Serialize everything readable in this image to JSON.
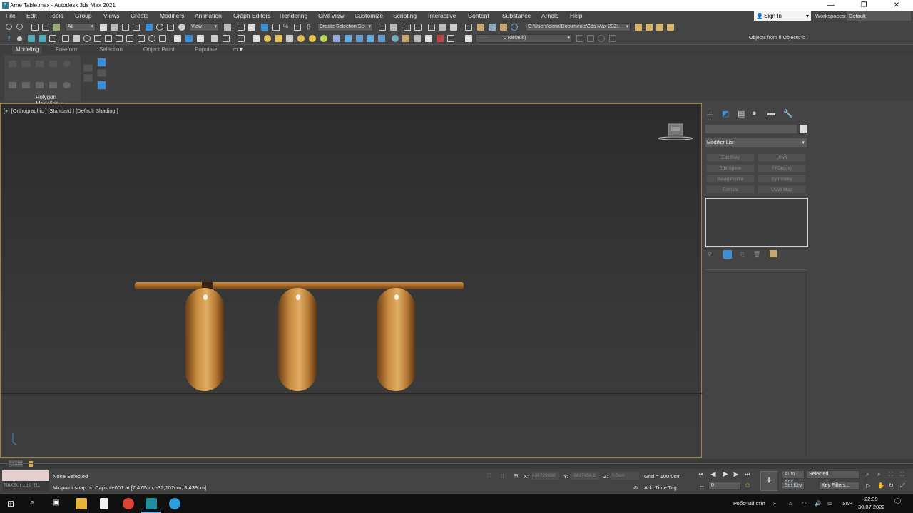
{
  "window": {
    "title": "Arne Table.max - Autodesk 3ds Max 2021",
    "minimize": "—",
    "restore": "❐",
    "close": "✕"
  },
  "menu": {
    "items": [
      "File",
      "Edit",
      "Tools",
      "Group",
      "Views",
      "Create",
      "Modifiers",
      "Animation",
      "Graph Editors",
      "Rendering",
      "Civil View",
      "Customize",
      "Scripting",
      "Interactive",
      "Content",
      "Substance",
      "Arnold",
      "Help"
    ],
    "sign_in": "Sign In",
    "workspaces_label": "Workspaces:",
    "workspace_value": "Default"
  },
  "toolbar": {
    "selection_filter": "All",
    "ref_coord": "View",
    "named_selection": "Create Selection Se",
    "project_path": "C:\\Users\\daria\\Documents\\3ds Max 2021",
    "layer": "0 (default)",
    "scene_explorer": "Objects from ȣ Objects to l"
  },
  "ribbon": {
    "tabs": [
      "Modeling",
      "Freeform",
      "Selection",
      "Object Paint",
      "Populate"
    ],
    "active_tab": "Modeling",
    "panel_label": "Polygon Modeling ▾"
  },
  "viewport": {
    "label": "[+] [Orthographic ] [Standard ] [Default Shading ]"
  },
  "command_panel": {
    "modifier_list": "Modifier List",
    "modifier_buttons": [
      "Edit Poly",
      "Unwl",
      "Edit Spline",
      "FFD(box)",
      "Bevel Profile",
      "Symmetry",
      "Extrude",
      "UVW Map"
    ]
  },
  "timeline": {
    "slider_label": "0 / 100"
  },
  "status": {
    "maxscript_placeholder": "MAXScript Mi",
    "selection": "None Selected",
    "prompt": "Midpoint snap on Capsule001 at [7,472cm, -32,102cm, 3,439cm]",
    "x_label": "X:",
    "x_value": "438729688",
    "y_label": "Y:",
    "y_value": "-3837456,1",
    "z_label": "Z:",
    "z_value": "0,0cm",
    "grid": "Grid = 100,0cm",
    "add_time_tag": "Add Time Tag",
    "auto_key": "Auto Key",
    "set_key": "Set Key",
    "key_mode": "Selected",
    "key_filters": "Key Filters...",
    "frame": "0"
  },
  "taskbar": {
    "desktop_label": "Робочий стіл",
    "lang": "УКР",
    "time": "22:39",
    "date": "30.07.2022"
  },
  "colors": {
    "viewport_border": "#a08538",
    "wood": "#b07830",
    "accent_blue": "#3a8fd8"
  }
}
